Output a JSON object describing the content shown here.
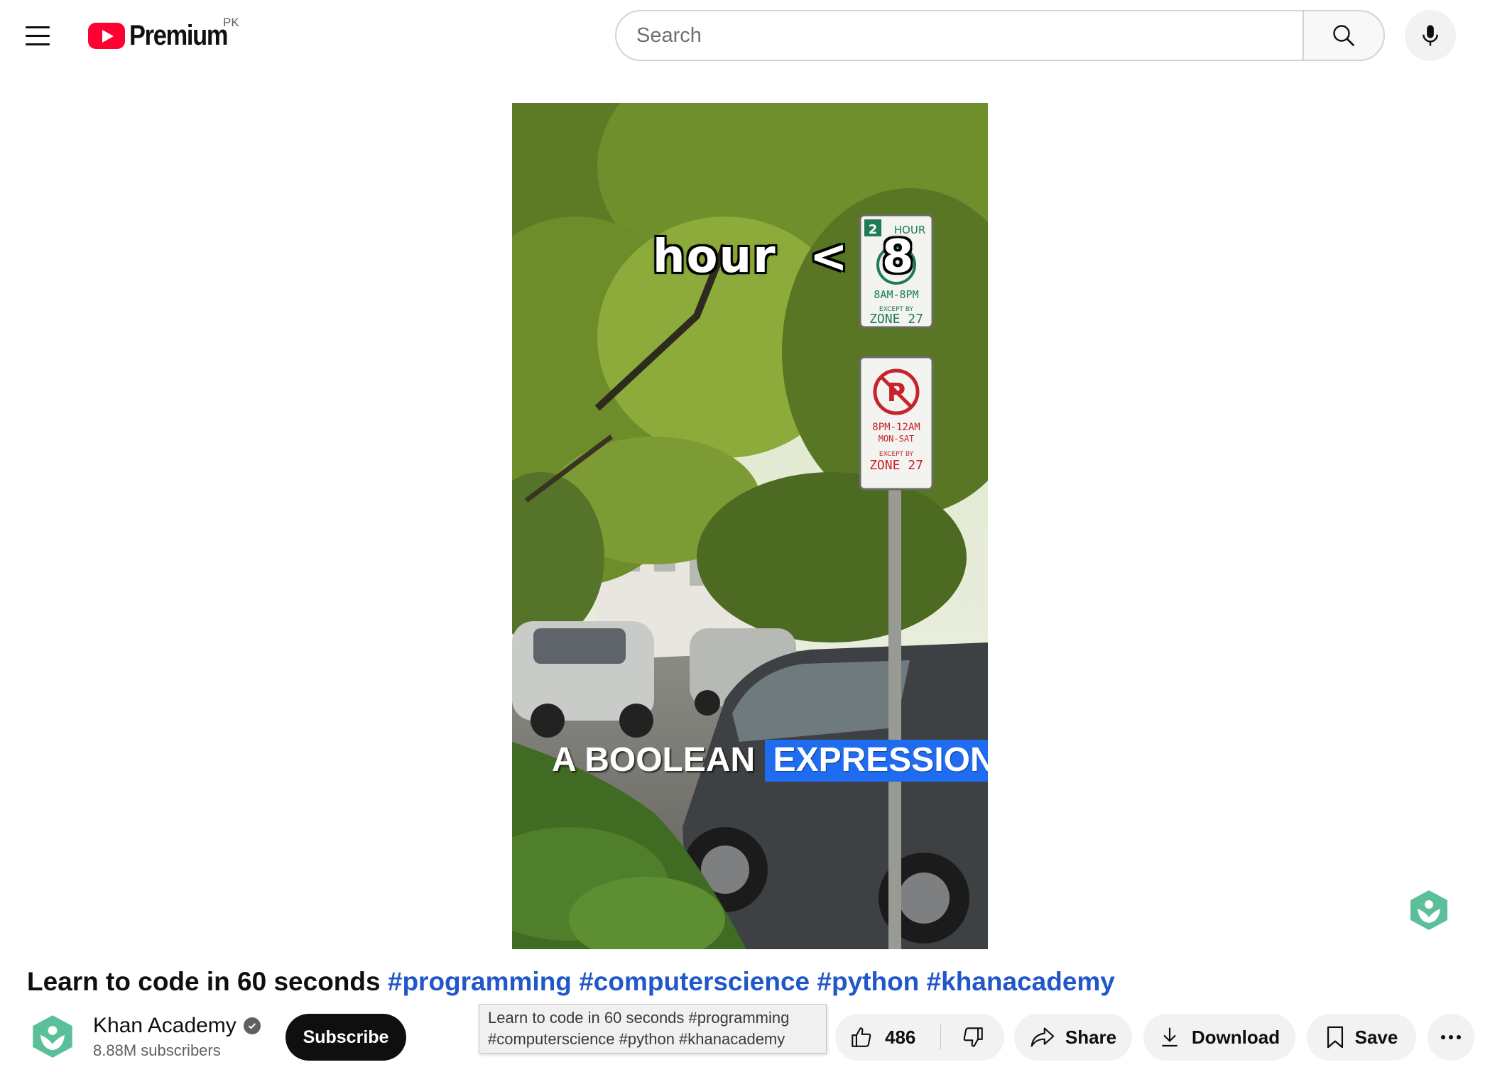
{
  "masthead": {
    "logo_text": "Premium",
    "country_code": "PK",
    "search_placeholder": "Search",
    "search_value": ""
  },
  "video": {
    "caption_top": "hour < 8",
    "caption_bottom_plain": "A BOOLEAN",
    "caption_bottom_highlight": "EXPRESSION.",
    "sign_upper": {
      "limit": "2",
      "limit_unit": "HOUR",
      "symbol": "P",
      "hours": "8AM-8PM",
      "exception": "EXCEPT BY",
      "zone": "ZONE 27"
    },
    "sign_lower": {
      "symbol": "P",
      "hours": "8PM-12AM",
      "days": "MON-SAT",
      "exception": "EXCEPT BY",
      "zone": "ZONE 27"
    }
  },
  "title": {
    "text": "Learn to code in 60 seconds",
    "hashtags": "#programming #computerscience #python #khanacademy"
  },
  "channel": {
    "name": "Khan Academy",
    "subscribers": "8.88M subscribers",
    "subscribe_label": "Subscribe"
  },
  "tooltip": {
    "line1": "Learn to code in 60 seconds #programming",
    "line2": "#computerscience #python #khanacademy"
  },
  "actions": {
    "like_count": "486",
    "share_label": "Share",
    "download_label": "Download",
    "save_label": "Save"
  },
  "colors": {
    "brand_red": "#ff0033",
    "hashtag_blue": "#2157c9",
    "khan_green": "#5bbf9a",
    "caption_highlight": "#1f6cf0"
  },
  "icons": {
    "menu": "hamburger-menu-icon",
    "search": "search-icon",
    "mic": "microphone-icon",
    "verified": "verified-check-icon",
    "like": "thumbs-up-icon",
    "dislike": "thumbs-down-icon",
    "share": "share-arrow-icon",
    "download": "download-icon",
    "save": "bookmark-icon",
    "more": "more-horizontal-icon"
  }
}
